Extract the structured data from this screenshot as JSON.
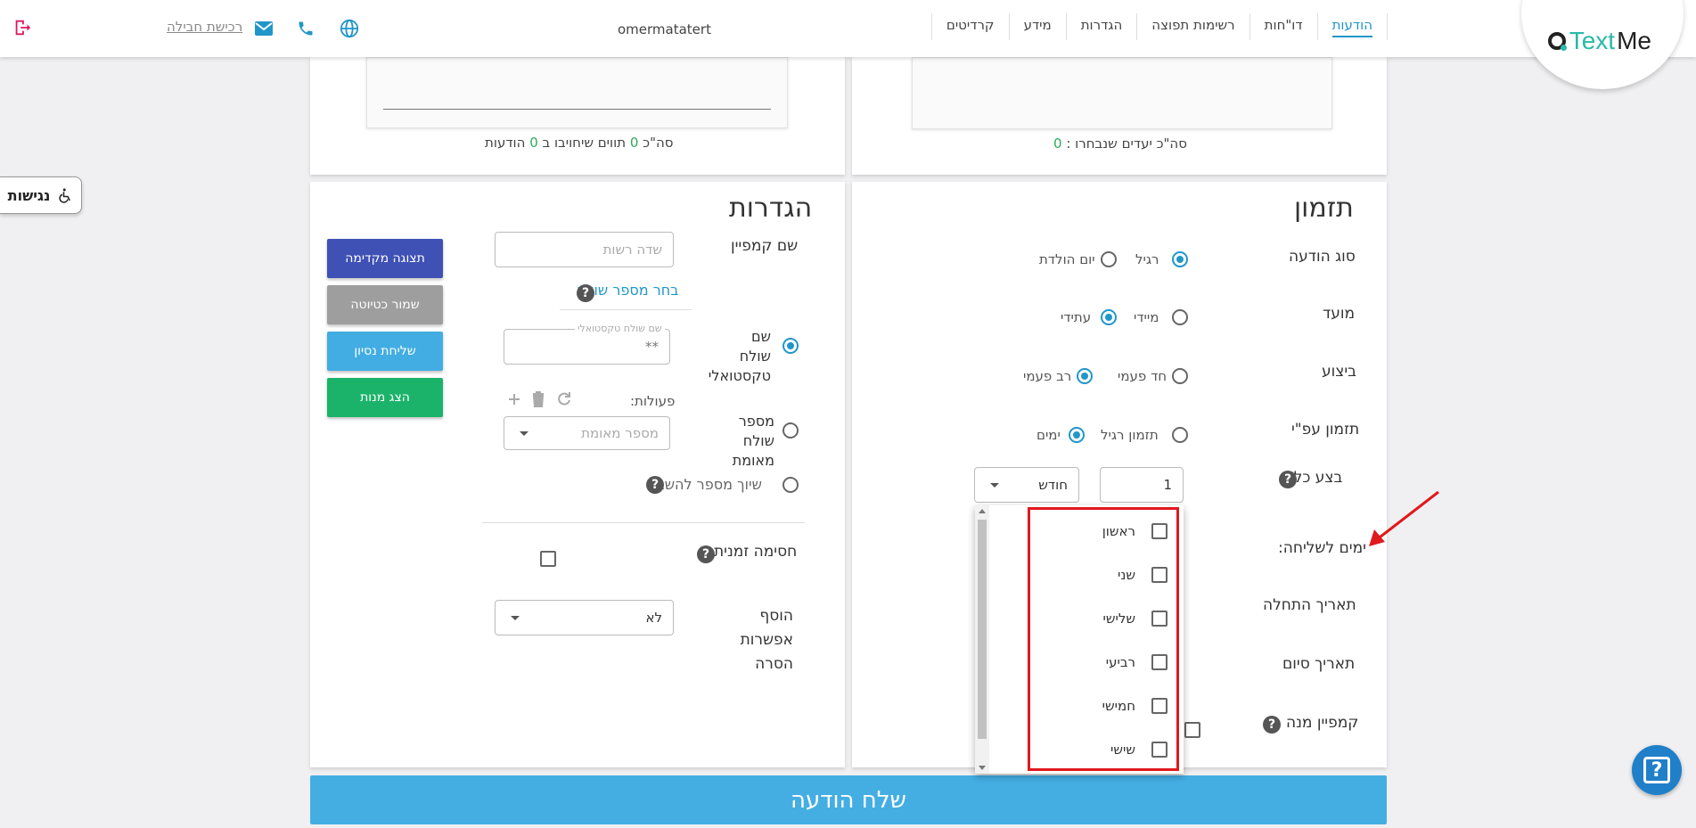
{
  "header": {
    "logo_part1": "Text",
    "logo_part2": "Me",
    "username": "omermatatert",
    "nav": [
      "הודעות",
      "דו\"חות",
      "רשימות תפוצה",
      "הגדרות",
      "מידע",
      "קרדיטים"
    ],
    "accessibility_link": "רכישת חבילה",
    "accent": "#2196c9"
  },
  "accessibility_button": "נגישות",
  "top_left_summary": {
    "prefix": "סה\"כ",
    "chars": "0",
    "mid": "תווים שיחויבו ב",
    "messages": "0",
    "suffix": "הודעות"
  },
  "top_right_summary": {
    "text": "סה\"כ יעדים שנבחרו :",
    "count": "0"
  },
  "schedule": {
    "title": "תזמון",
    "message_type_label": "סוג הודעה",
    "message_type_opts": [
      "רגיל",
      "יום הולדת"
    ],
    "timing_label": "מועד",
    "timing_opts": [
      "מיידי",
      "עתידי"
    ],
    "execution_label": "ביצוע",
    "execution_opts": [
      "חד פעמי",
      "רב פעמי"
    ],
    "schedule_by_label": "תזמון עפ\"י",
    "schedule_by_opts": [
      "תזמון רגיל",
      "ימים"
    ],
    "every_label": "בצע כל:",
    "every_value": "1",
    "period_value": "חודש",
    "days_label": "ימים לשליחה:",
    "start_label": "תאריך התחלה",
    "end_label": "תאריך סיום",
    "subscription_label": "קמפיין מנה"
  },
  "days_dropdown": [
    "ראשון",
    "שני",
    "שלישי",
    "רביעי",
    "חמישי",
    "שישי"
  ],
  "settings": {
    "title": "הגדרות",
    "campaign_name_label": "שם קמפיין",
    "campaign_name_placeholder": "שדה רשות",
    "choose_sender_link": "בחר מספר שולח",
    "text_sender_label": "שם שולח טקסטואלי",
    "text_sender_float": "שם שולח טקסטואלי",
    "text_sender_value": "**",
    "actions_label": "פעולות:",
    "verified_sender_label": "מספר שולח מאומת",
    "verified_sender_placeholder": "מספר מאומת",
    "reply_number_label": "שיוך מספר להשבה",
    "temp_block_label": "חסימה זמנית",
    "add_removal_label": "הוסף אפשרות הסרה",
    "add_removal_value": "לא"
  },
  "side_buttons": {
    "preview": "תצוגה מקדימה",
    "save_draft": "שמור כטיוטה",
    "test_send": "שליחת נסיון",
    "show_packages": "הצג מנות",
    "colors": {
      "preview": "#3f51b5",
      "save_draft": "#9e9e9e",
      "test_send": "#42ade2",
      "show_packages": "#1bb36a"
    }
  },
  "send_button": "שלח הודעה"
}
